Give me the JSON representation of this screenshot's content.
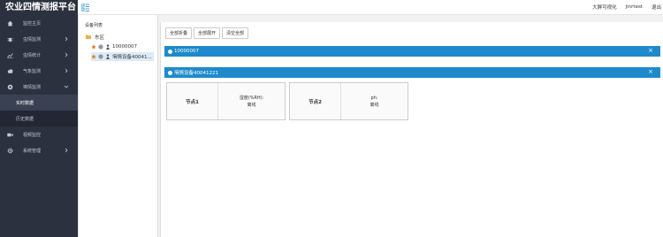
{
  "app": {
    "title": "农业四情测报平台"
  },
  "header": {
    "links": [
      "大屏可视化",
      "jinrtest",
      "退出"
    ]
  },
  "sidebar": {
    "items": [
      {
        "label": "监控主页",
        "icon": "home-icon"
      },
      {
        "label": "虫情监测",
        "icon": "bug-icon"
      },
      {
        "label": "虫情统计",
        "icon": "chart-icon"
      },
      {
        "label": "气象监测",
        "icon": "cloud-icon"
      },
      {
        "label": "墒情监测",
        "icon": "soil-icon"
      }
    ],
    "sub_items": [
      "实时数据",
      "历史数据"
    ],
    "items_after": [
      {
        "label": "视频监控",
        "icon": "video-icon"
      },
      {
        "label": "系统管理",
        "icon": "gear-icon"
      }
    ]
  },
  "tree": {
    "title": "设备列表",
    "root": "东区",
    "nodes": [
      "10000007",
      "墒情设备40041..."
    ]
  },
  "toolbar": {
    "collapse_all": "全部折叠",
    "expand_all": "全部展开",
    "clear_all": "清空全部"
  },
  "panels": [
    {
      "title": "10000007"
    },
    {
      "title": "墒情设备40041221"
    }
  ],
  "cards": [
    {
      "node": "节点1",
      "metric": "湿度(%RH):",
      "status": "离线"
    },
    {
      "node": "节点2",
      "metric": "ph:",
      "status": "离线"
    }
  ],
  "colors": {
    "sidebar_bg": "#2b313f",
    "accent": "#1e8acb"
  }
}
